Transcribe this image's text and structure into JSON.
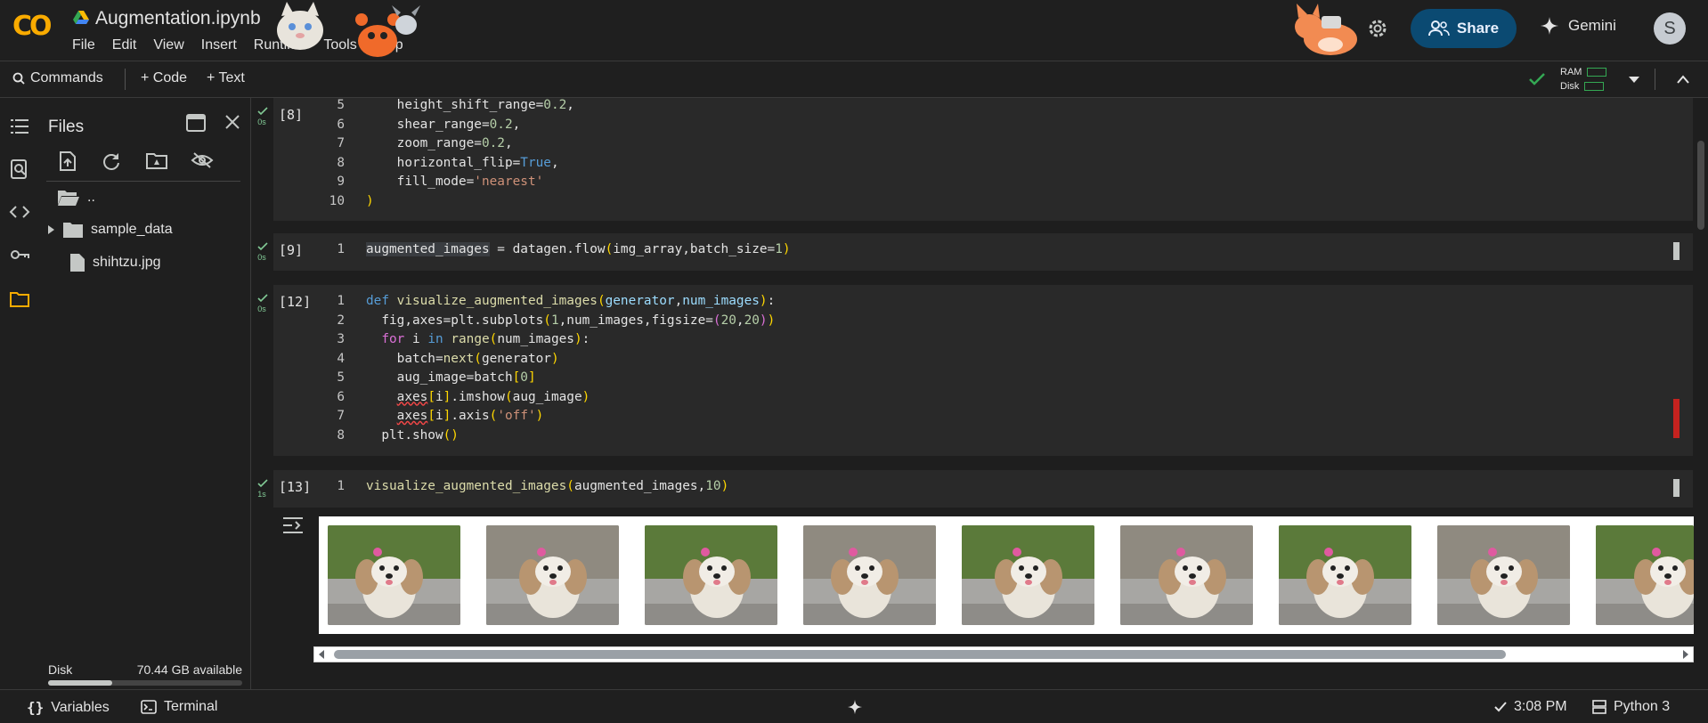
{
  "app": {
    "title": "Augmentation.ipynb",
    "logo": "CO",
    "menu": [
      "File",
      "Edit",
      "View",
      "Insert",
      "Runtime",
      "Tools",
      "Help"
    ],
    "share_label": "Share",
    "gemini_label": "Gemini",
    "avatar_letter": "S",
    "colors": {
      "accent": "#f9ab00",
      "share_bg": "#0b4a72",
      "ok": "#34a853"
    }
  },
  "toolbar": {
    "commands_label": "Commands",
    "code_label": "+ Code",
    "text_label": "+ Text",
    "ram_label": "RAM",
    "disk_label": "Disk"
  },
  "sidebar": {
    "title": "Files",
    "items": [
      {
        "name": "..",
        "icon": "folder-open-icon"
      },
      {
        "name": "sample_data",
        "icon": "folder-icon"
      },
      {
        "name": "shihtzu.jpg",
        "icon": "file-icon"
      }
    ],
    "disk_label": "Disk",
    "disk_available": "70.44 GB available",
    "disk_used_fraction": 0.33
  },
  "cells": [
    {
      "exec": "[8]",
      "status": "0s"
    },
    {
      "exec": "[9]",
      "status": "0s"
    },
    {
      "exec": "[12]",
      "status": "0s"
    },
    {
      "exec": "[13]",
      "status": "1s"
    }
  ],
  "statusbar": {
    "variables_label": "Variables",
    "terminal_label": "Terminal",
    "time": "3:08 PM",
    "kernel": "Python 3"
  },
  "output": {
    "thumbnail_count": 10
  }
}
